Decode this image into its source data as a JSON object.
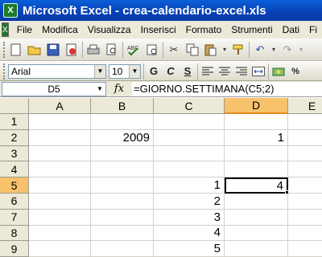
{
  "window": {
    "title": "Microsoft Excel - crea-calendario-excel.xls"
  },
  "menu": [
    "File",
    "Modifica",
    "Visualizza",
    "Inserisci",
    "Formato",
    "Strumenti",
    "Dati",
    "Fi"
  ],
  "format_toolbar": {
    "font": "Arial",
    "size": "10",
    "bold": "G",
    "italic": "C",
    "underline": "S"
  },
  "formula_bar": {
    "name_box": "D5",
    "fx": "fx",
    "formula": "=GIORNO.SETTIMANA(C5;2)"
  },
  "columns": [
    "A",
    "B",
    "C",
    "D",
    "E"
  ],
  "selected_column": "D",
  "rows": [
    "1",
    "2",
    "3",
    "4",
    "5",
    "6",
    "7",
    "8",
    "9"
  ],
  "selected_row": "5",
  "cells": {
    "B2": "2009",
    "D2": "1",
    "C5": "1",
    "D5": "4",
    "C6": "2",
    "C7": "3",
    "C8": "4",
    "C9": "5"
  },
  "icons": [
    "excel-app-icon",
    "workbook-icon",
    "new-icon",
    "open-icon",
    "save-icon",
    "permission-icon",
    "print-icon",
    "print-preview-icon",
    "spelling-icon",
    "research-icon",
    "cut-icon",
    "copy-icon",
    "paste-icon",
    "format-painter-icon",
    "undo-icon",
    "redo-icon",
    "align-left-icon",
    "align-center-icon",
    "align-right-icon",
    "merge-center-icon",
    "currency-icon"
  ]
}
